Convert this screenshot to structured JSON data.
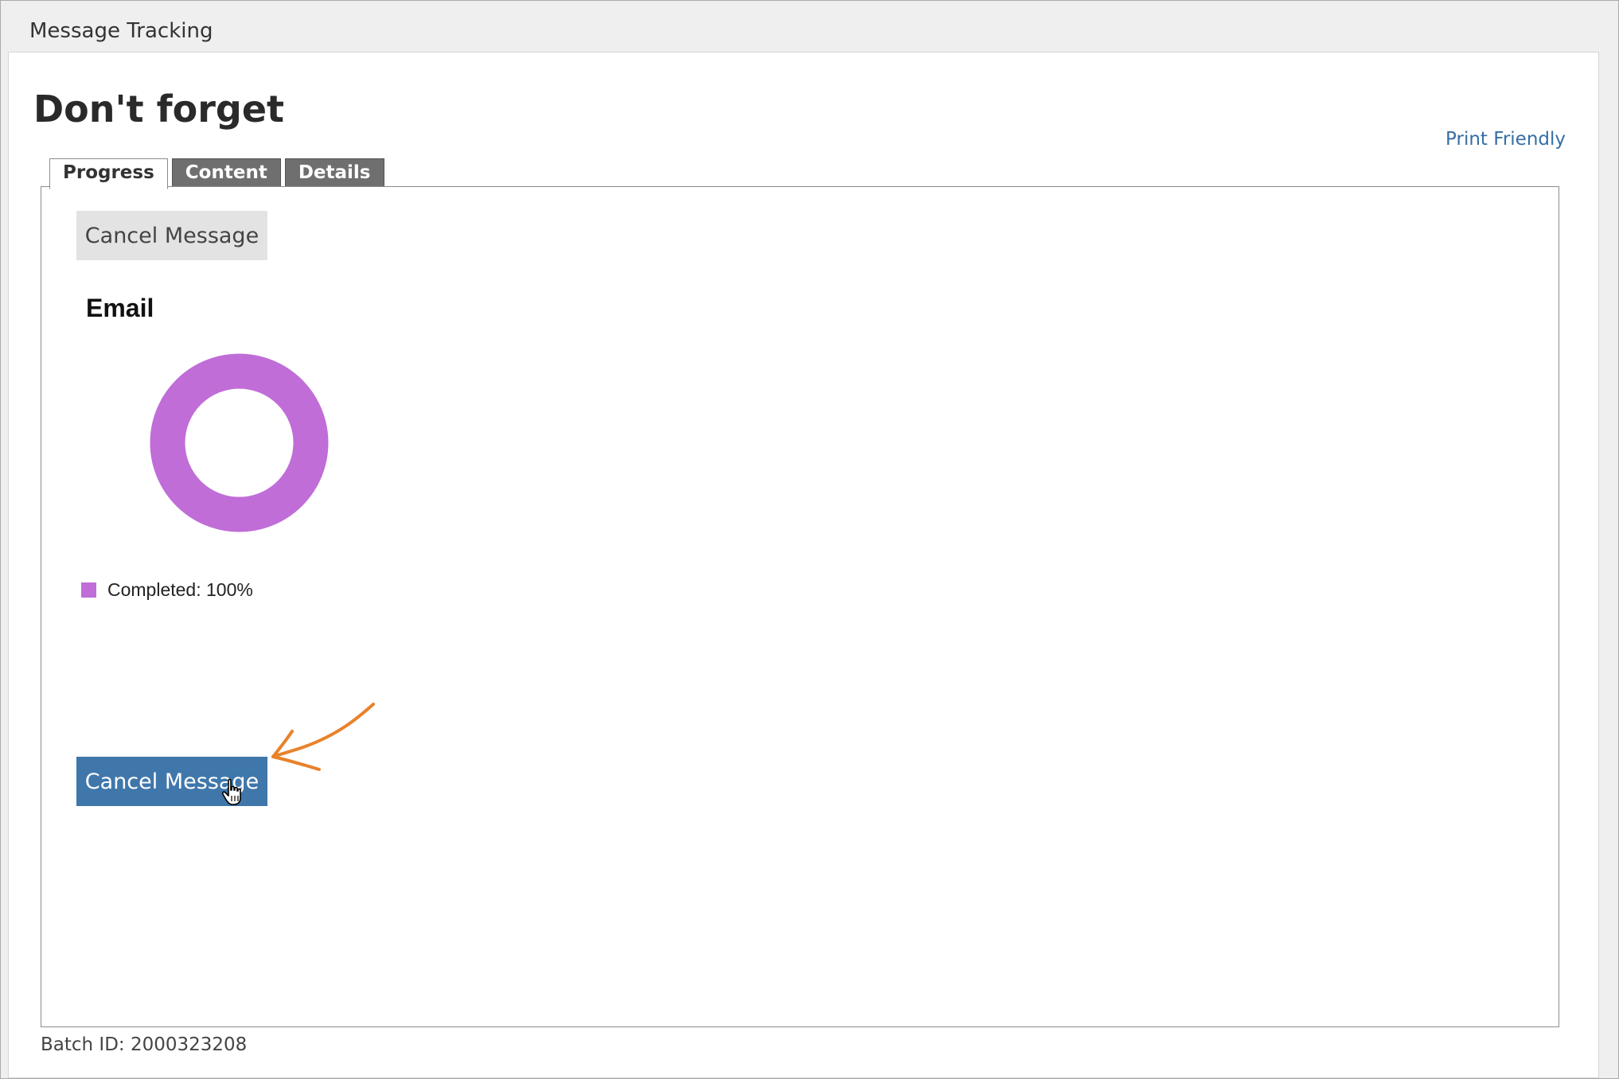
{
  "window": {
    "title": "Message Tracking"
  },
  "page": {
    "title": "Don't forget",
    "print_link": "Print Friendly"
  },
  "tabs": [
    {
      "label": "Progress",
      "active": true
    },
    {
      "label": "Content",
      "active": false
    },
    {
      "label": "Details",
      "active": false
    }
  ],
  "progress": {
    "cancel_button_label": "Cancel Message",
    "section_title": "Email",
    "legend": [
      {
        "label": "Completed: 100%",
        "color": "#c06dd8",
        "percent": 100
      }
    ],
    "primary_cancel_button_label": "Cancel Message"
  },
  "footer": {
    "batch_id": "Batch ID: 2000323208"
  },
  "colors": {
    "accent": "#3f77ab",
    "donut": "#c06dd8",
    "link": "#356ea5",
    "annotation_arrow": "#e8822a"
  },
  "icons": {
    "cursor": "hand-pointer-icon",
    "annotation": "arrow-annotation-icon"
  },
  "chart_data": {
    "type": "pie",
    "categories": [
      "Completed"
    ],
    "values": [
      100
    ],
    "title": "Email"
  }
}
